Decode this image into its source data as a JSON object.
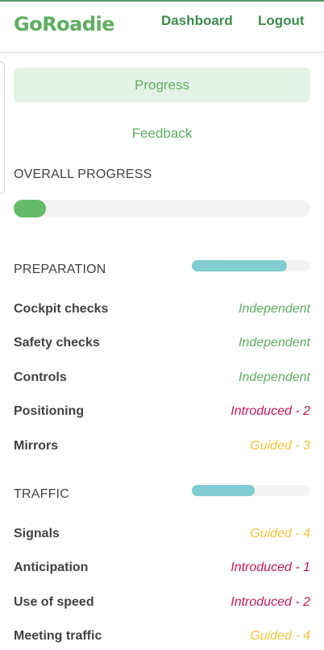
{
  "header": {
    "logo": "GoRoadie",
    "nav": {
      "dashboard": "Dashboard",
      "logout": "Logout"
    }
  },
  "tabs": {
    "progress": "Progress",
    "feedback": "Feedback"
  },
  "overall": {
    "label": "OVERALL PROGRESS",
    "percent": 11
  },
  "categories": [
    {
      "title": "PREPARATION",
      "percent": 80,
      "skills": [
        {
          "name": "Cockpit checks",
          "status": "Independent",
          "level": "independent"
        },
        {
          "name": "Safety checks",
          "status": "Independent",
          "level": "independent"
        },
        {
          "name": "Controls",
          "status": "Independent",
          "level": "independent"
        },
        {
          "name": "Positioning",
          "status": "Introduced - 2",
          "level": "introduced"
        },
        {
          "name": "Mirrors",
          "status": "Guided - 3",
          "level": "guided"
        }
      ]
    },
    {
      "title": "TRAFFIC",
      "percent": 53,
      "skills": [
        {
          "name": "Signals",
          "status": "Guided - 4",
          "level": "guided"
        },
        {
          "name": "Anticipation",
          "status": "Introduced - 1",
          "level": "introduced"
        },
        {
          "name": "Use of speed",
          "status": "Introduced - 2",
          "level": "introduced"
        },
        {
          "name": "Meeting traffic",
          "status": "Guided - 4",
          "level": "guided"
        }
      ]
    }
  ],
  "colors": {
    "brand": "#5fae63",
    "independent": "#5fae63",
    "introduced": "#c2185b",
    "guided": "#f2c43d",
    "category_bar": "#80cdd2",
    "overall_bar": "#66bb6a"
  }
}
